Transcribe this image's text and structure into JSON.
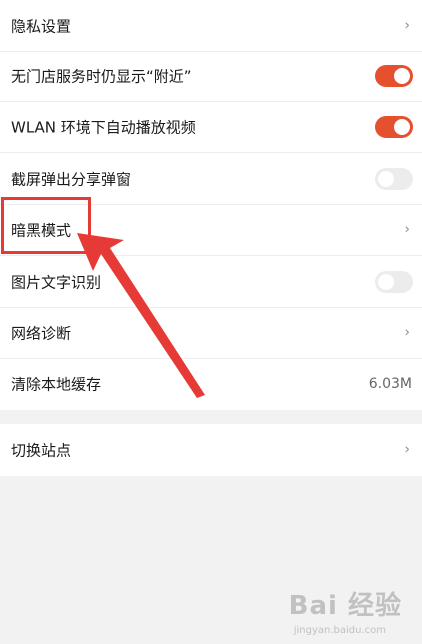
{
  "settings": {
    "group1": [
      {
        "label": "隐私设置",
        "control": "chevron",
        "chevron": "›"
      },
      {
        "label": "无门店服务时仍显示“附近”",
        "control": "toggle",
        "state": "on"
      },
      {
        "label": "WLAN 环境下自动播放视频",
        "control": "toggle",
        "state": "on"
      },
      {
        "label": "截屏弹出分享弹窗",
        "control": "toggle",
        "state": "off"
      },
      {
        "label": "暗黑模式",
        "control": "chevron",
        "chevron": "›"
      },
      {
        "label": "图片文字识别",
        "control": "toggle",
        "state": "off"
      },
      {
        "label": "网络诊断",
        "control": "chevron",
        "chevron": "›"
      },
      {
        "label": "清除本地缓存",
        "control": "value",
        "value": "6.03M"
      }
    ],
    "group2": [
      {
        "label": "切换站点",
        "control": "chevron",
        "chevron": "›"
      }
    ]
  },
  "colors": {
    "toggle_on": "#e5502e",
    "toggle_off": "#ececec",
    "annotation": "#e53a35",
    "background": "#f2f2f2"
  },
  "watermark": {
    "logo": "Bai 经验",
    "sub": "jingyan.baidu.com"
  }
}
